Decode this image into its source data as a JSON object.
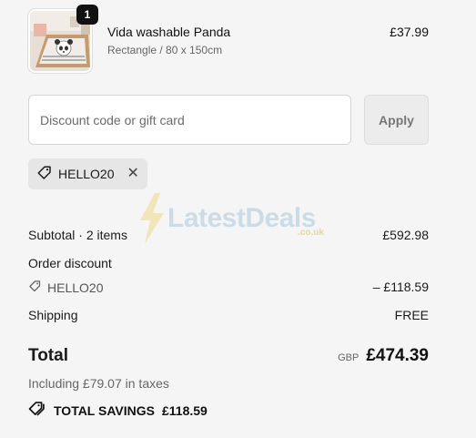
{
  "product": {
    "quantity": "1",
    "name": "Vida washable Panda",
    "variant": "Rectangle / 80 x 150cm",
    "price": "£37.99"
  },
  "discount": {
    "placeholder": "Discount code or gift card",
    "value": "",
    "apply_label": "Apply",
    "applied_code": "HELLO20"
  },
  "watermark": {
    "text": "LatestDeals",
    "suffix": ".co.uk"
  },
  "summary": {
    "subtotal_label": "Subtotal · 2 items",
    "subtotal_value": "£592.98",
    "order_discount_label": "Order discount",
    "discount_code": "HELLO20",
    "discount_value": "– £118.59",
    "shipping_label": "Shipping",
    "shipping_value": "FREE",
    "total_label": "Total",
    "currency": "GBP",
    "total_value": "£474.39",
    "taxes_note": "Including £79.07 in taxes",
    "savings_label": "TOTAL SAVINGS",
    "savings_value": "£118.59"
  }
}
